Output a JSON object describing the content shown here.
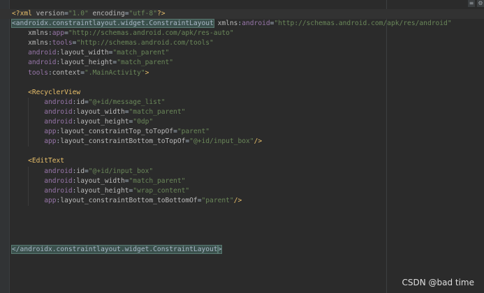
{
  "icons": {
    "menu": "hamburger-icon",
    "settings": "settings-icon"
  },
  "lines": [
    {
      "tokens": [
        {
          "c": "punc",
          "t": "<?"
        },
        {
          "c": "tag",
          "t": "xml "
        },
        {
          "c": "attr",
          "t": "version"
        },
        {
          "c": "brk",
          "t": "="
        },
        {
          "c": "val",
          "t": "\"1.0\" "
        },
        {
          "c": "attr",
          "t": "encoding"
        },
        {
          "c": "brk",
          "t": "="
        },
        {
          "c": "val",
          "t": "\"utf-8\""
        },
        {
          "c": "punc",
          "t": "?>"
        }
      ]
    },
    {
      "tokens": [
        {
          "c": "tag-match",
          "t": "<androidx.constraintlayout.widget.ConstraintLayout"
        },
        {
          "c": "attr",
          "t": " xmlns"
        },
        {
          "c": "brk",
          "t": ":"
        },
        {
          "c": "pfx",
          "t": "android"
        },
        {
          "c": "brk",
          "t": "="
        },
        {
          "c": "val",
          "t": "\"http://schemas.android.com/apk/res/android\""
        }
      ]
    },
    {
      "tokens": [
        {
          "c": "attr",
          "t": "    xmlns"
        },
        {
          "c": "brk",
          "t": ":"
        },
        {
          "c": "pfx",
          "t": "app"
        },
        {
          "c": "brk",
          "t": "="
        },
        {
          "c": "val",
          "t": "\"http://schemas.android.com/apk/res-auto\""
        }
      ]
    },
    {
      "tokens": [
        {
          "c": "attr",
          "t": "    xmlns"
        },
        {
          "c": "brk",
          "t": ":"
        },
        {
          "c": "pfx",
          "t": "tools"
        },
        {
          "c": "brk",
          "t": "="
        },
        {
          "c": "val",
          "t": "\"http://schemas.android.com/tools\""
        }
      ]
    },
    {
      "tokens": [
        {
          "c": "pfx",
          "t": "    android"
        },
        {
          "c": "brk",
          "t": ":"
        },
        {
          "c": "attr",
          "t": "layout_width"
        },
        {
          "c": "brk",
          "t": "="
        },
        {
          "c": "val",
          "t": "\"match_parent\""
        }
      ]
    },
    {
      "tokens": [
        {
          "c": "pfx",
          "t": "    android"
        },
        {
          "c": "brk",
          "t": ":"
        },
        {
          "c": "attr",
          "t": "layout_height"
        },
        {
          "c": "brk",
          "t": "="
        },
        {
          "c": "val",
          "t": "\"match_parent\""
        }
      ]
    },
    {
      "tokens": [
        {
          "c": "pfx",
          "t": "    tools"
        },
        {
          "c": "brk",
          "t": ":"
        },
        {
          "c": "attr",
          "t": "context"
        },
        {
          "c": "brk",
          "t": "="
        },
        {
          "c": "val",
          "t": "\".MainActivity\""
        },
        {
          "c": "tag",
          "t": ">"
        }
      ]
    },
    {
      "tokens": []
    },
    {
      "tokens": [
        {
          "c": "tag",
          "t": "    <RecyclerView"
        }
      ]
    },
    {
      "tokens": [
        {
          "c": "pfx",
          "t": "        android"
        },
        {
          "c": "brk",
          "t": ":"
        },
        {
          "c": "attr",
          "t": "id"
        },
        {
          "c": "brk",
          "t": "="
        },
        {
          "c": "val",
          "t": "\"@+id/message_list\""
        }
      ]
    },
    {
      "tokens": [
        {
          "c": "pfx",
          "t": "        android"
        },
        {
          "c": "brk",
          "t": ":"
        },
        {
          "c": "attr",
          "t": "layout_width"
        },
        {
          "c": "brk",
          "t": "="
        },
        {
          "c": "val",
          "t": "\"match_parent\""
        }
      ]
    },
    {
      "tokens": [
        {
          "c": "pfx",
          "t": "        android"
        },
        {
          "c": "brk",
          "t": ":"
        },
        {
          "c": "attr",
          "t": "layout_height"
        },
        {
          "c": "brk",
          "t": "="
        },
        {
          "c": "val",
          "t": "\"0dp\""
        }
      ]
    },
    {
      "tokens": [
        {
          "c": "pfx",
          "t": "        app"
        },
        {
          "c": "brk",
          "t": ":"
        },
        {
          "c": "attr",
          "t": "layout_constraintTop_toTopOf"
        },
        {
          "c": "brk",
          "t": "="
        },
        {
          "c": "val",
          "t": "\"parent\""
        }
      ]
    },
    {
      "tokens": [
        {
          "c": "pfx",
          "t": "        app"
        },
        {
          "c": "brk",
          "t": ":"
        },
        {
          "c": "attr",
          "t": "layout_constraintBottom_toTopOf"
        },
        {
          "c": "brk",
          "t": "="
        },
        {
          "c": "val",
          "t": "\"@+id/input_box\""
        },
        {
          "c": "tag",
          "t": "/>"
        }
      ]
    },
    {
      "tokens": []
    },
    {
      "tokens": [
        {
          "c": "tag",
          "t": "    <EditText"
        }
      ]
    },
    {
      "tokens": [
        {
          "c": "pfx",
          "t": "        android"
        },
        {
          "c": "brk",
          "t": ":"
        },
        {
          "c": "attr",
          "t": "id"
        },
        {
          "c": "brk",
          "t": "="
        },
        {
          "c": "val",
          "t": "\"@+id/input_box\""
        }
      ]
    },
    {
      "tokens": [
        {
          "c": "pfx",
          "t": "        android"
        },
        {
          "c": "brk",
          "t": ":"
        },
        {
          "c": "attr",
          "t": "layout_width"
        },
        {
          "c": "brk",
          "t": "="
        },
        {
          "c": "val",
          "t": "\"match_parent\""
        }
      ]
    },
    {
      "tokens": [
        {
          "c": "pfx",
          "t": "        android"
        },
        {
          "c": "brk",
          "t": ":"
        },
        {
          "c": "attr",
          "t": "layout_height"
        },
        {
          "c": "brk",
          "t": "="
        },
        {
          "c": "val",
          "t": "\"wrap_content\""
        }
      ]
    },
    {
      "tokens": [
        {
          "c": "pfx",
          "t": "        app"
        },
        {
          "c": "brk",
          "t": ":"
        },
        {
          "c": "attr",
          "t": "layout_constraintBottom_toBottomOf"
        },
        {
          "c": "brk",
          "t": "="
        },
        {
          "c": "val",
          "t": "\"parent\""
        },
        {
          "c": "tag",
          "t": "/>"
        }
      ]
    },
    {
      "tokens": []
    },
    {
      "tokens": []
    },
    {
      "tokens": []
    },
    {
      "tokens": []
    },
    {
      "tokens": [
        {
          "c": "tag-match",
          "t": "</androidx.constraintlayout.widget.ConstraintLayout"
        },
        {
          "c": "bracket-match",
          "t": ">"
        }
      ]
    }
  ],
  "watermark": "CSDN @bad time"
}
